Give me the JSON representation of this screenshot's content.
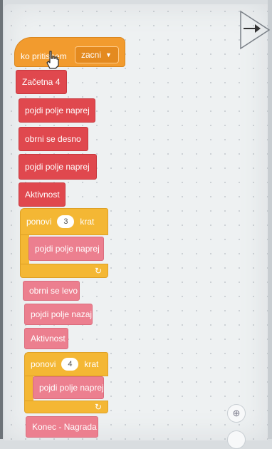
{
  "hat": {
    "text": "ko pritisnem",
    "dropdown": "zacni"
  },
  "blocks": {
    "b1": "Začetna 4",
    "b2": "pojdi polje naprej",
    "b3": "obrni se desno",
    "b4": "pojdi polje naprej",
    "b5": "Aktivnost",
    "loop1": {
      "label": "ponovi",
      "count": "3",
      "suffix": "krat",
      "inner": "pojdi polje naprej"
    },
    "b6": "obrni se levo",
    "b7": "pojdi polje nazaj",
    "b8": "Aktivnost",
    "loop2": {
      "label": "ponovi",
      "count": "4",
      "suffix": "krat",
      "inner": "pojdi polje naprej"
    },
    "b9": "Konec - Nagrada"
  },
  "zoom": {
    "in_icon": "zoom-in-icon"
  },
  "colors": {
    "event": "#f29b2e",
    "motion": "#e0484e",
    "custom": "#ec7f8f",
    "control": "#f4b734"
  }
}
